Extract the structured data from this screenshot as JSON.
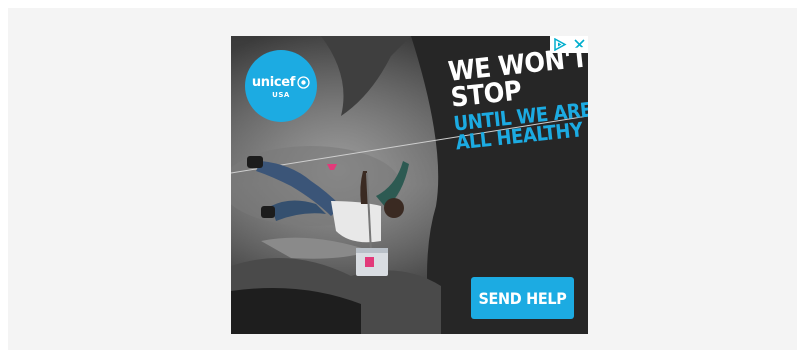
{
  "ad": {
    "logo": {
      "name": "unicef",
      "subtitle": "USA"
    },
    "headline": {
      "line1": "WE WON'T",
      "line2": "STOP",
      "line3": "UNTIL WE ARE",
      "line4": "ALL HEALTHY"
    },
    "cta_label": "SEND HELP"
  },
  "colors": {
    "brand_blue": "#1cabe2",
    "page_bg": "#f4f4f4"
  }
}
